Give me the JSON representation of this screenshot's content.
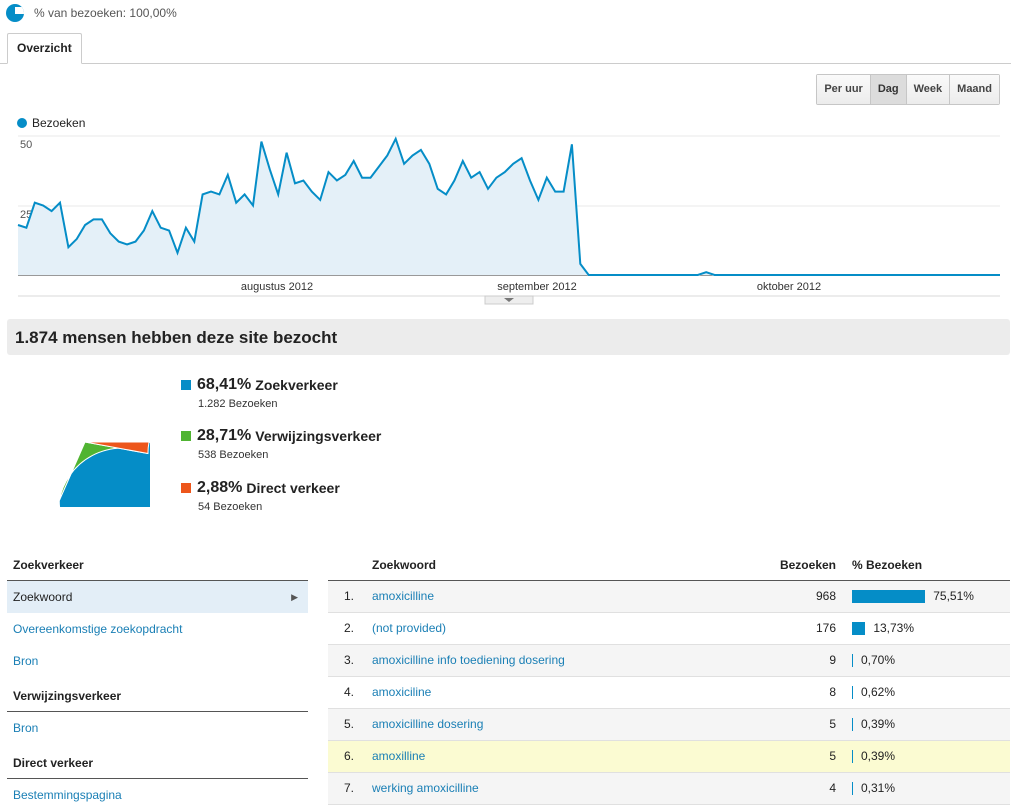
{
  "segment": {
    "label": "% van bezoeken: 100,00%"
  },
  "tabs": [
    {
      "label": "Overzicht"
    }
  ],
  "granularity": {
    "buttons": [
      "Per uur",
      "Dag",
      "Week",
      "Maand"
    ],
    "active": "Dag"
  },
  "chart_data": {
    "type": "area",
    "series": [
      {
        "name": "Bezoeken",
        "color": "#058dc7",
        "values": [
          18,
          17,
          26,
          25,
          23,
          26,
          10,
          13,
          18,
          20,
          20,
          15,
          12,
          11,
          12,
          16,
          23,
          17,
          16,
          8,
          17,
          12,
          29,
          30,
          29,
          36,
          26,
          29,
          25,
          48,
          38,
          29,
          44,
          33,
          34,
          30,
          27,
          37,
          34,
          36,
          41,
          35,
          35,
          39,
          43,
          49,
          40,
          43,
          45,
          40,
          31,
          29,
          34,
          41,
          35,
          37,
          31,
          35,
          37,
          40,
          42,
          34,
          27,
          35,
          30,
          30,
          47,
          4,
          0,
          0,
          0,
          0,
          0,
          0,
          0,
          0,
          0,
          0,
          0,
          0,
          0,
          0,
          1,
          0,
          0,
          0,
          0,
          0,
          0,
          0,
          0,
          0,
          0,
          0,
          0,
          0,
          0,
          0,
          0,
          0,
          0,
          0,
          0,
          0,
          0,
          0,
          0,
          0,
          0,
          0,
          0,
          0,
          0,
          0,
          0,
          0,
          0,
          0
        ]
      }
    ],
    "yticks": [
      "50",
      "25"
    ],
    "xticks": [
      "augustus 2012",
      "september 2012",
      "oktober 2012"
    ],
    "ylim": [
      0,
      50
    ]
  },
  "summary": {
    "headline": "1.874 mensen hebben deze site bezocht"
  },
  "sources": [
    {
      "pct": "68,41%",
      "name": "Zoekverkeer",
      "visits": "1.282 Bezoeken",
      "color": "#058dc7",
      "share": 68.41
    },
    {
      "pct": "28,71%",
      "name": "Verwijzingsverkeer",
      "visits": "538 Bezoeken",
      "color": "#50b432",
      "share": 28.71
    },
    {
      "pct": "2,88%",
      "name": "Direct verkeer",
      "visits": "54 Bezoeken",
      "color": "#ed561b",
      "share": 2.88
    }
  ],
  "nav": {
    "search_head": "Zoekverkeer",
    "search_items": [
      "Zoekwoord",
      "Overeenkomstige zoekopdracht",
      "Bron"
    ],
    "referral_head": "Verwijzingsverkeer",
    "referral_items": [
      "Bron"
    ],
    "direct_head": "Direct verkeer",
    "direct_items": [
      "Bestemmingspagina"
    ]
  },
  "table": {
    "headers": {
      "keyword": "Zoekwoord",
      "visits": "Bezoeken",
      "pct": "% Bezoeken"
    },
    "rows": [
      {
        "n": "1.",
        "kw": "amoxicilline",
        "visits": "968",
        "pct": "75,51%",
        "share": 75.51
      },
      {
        "n": "2.",
        "kw": "(not provided)",
        "visits": "176",
        "pct": "13,73%",
        "share": 13.73
      },
      {
        "n": "3.",
        "kw": "amoxicilline info toediening dosering",
        "visits": "9",
        "pct": "0,70%",
        "share": 0.7
      },
      {
        "n": "4.",
        "kw": "amoxiciline",
        "visits": "8",
        "pct": "0,62%",
        "share": 0.62
      },
      {
        "n": "5.",
        "kw": "amoxicilline dosering",
        "visits": "5",
        "pct": "0,39%",
        "share": 0.39
      },
      {
        "n": "6.",
        "kw": "amoxilline",
        "visits": "5",
        "pct": "0,39%",
        "share": 0.39
      },
      {
        "n": "7.",
        "kw": "werking amoxicilline",
        "visits": "4",
        "pct": "0,31%",
        "share": 0.31
      }
    ]
  }
}
